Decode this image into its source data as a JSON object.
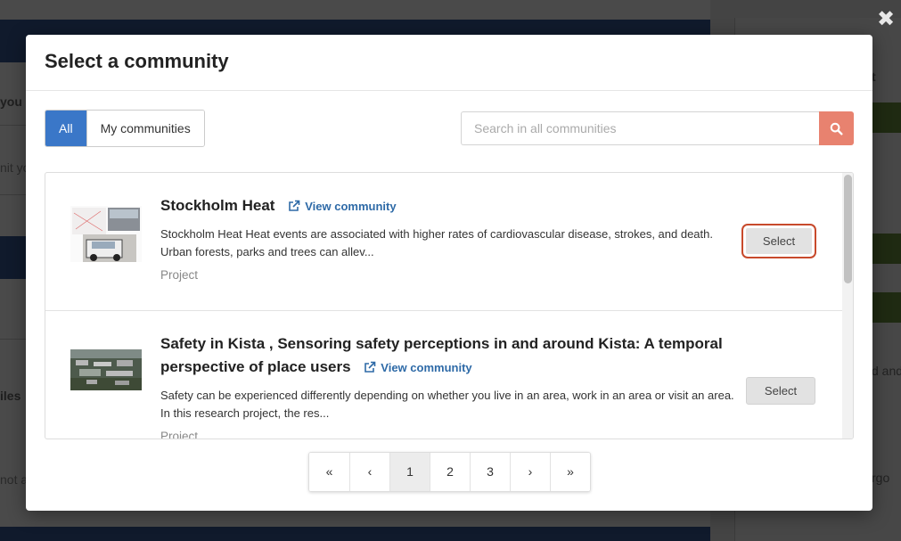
{
  "modal": {
    "title": "Select a community",
    "close_glyph": "✖"
  },
  "filters": {
    "all_label": "All",
    "mine_label": "My communities",
    "active": "All"
  },
  "search": {
    "placeholder": "Search in all communities",
    "value": "",
    "icon": "search-icon",
    "button_color": "#e8826f"
  },
  "communities": [
    {
      "title": "Stockholm Heat",
      "link_label": "View community",
      "description": "Stockholm Heat Heat events are associated with higher rates of cardiovascular disease, strokes, and death. Urban forests, parks and trees can allev...",
      "type": "Project",
      "select_label": "Select",
      "focused": true
    },
    {
      "title": "Safety in Kista , Sensoring safety perceptions in and around Kista: A temporal perspective of place users",
      "link_label": "View community",
      "description": "Safety can be experienced differently depending on whether you live in an area, work in an area or visit an area. In this research project, the res...",
      "type": "Project",
      "select_label": "Select",
      "focused": false
    }
  ],
  "pagination": {
    "first": "«",
    "prev": "‹",
    "pages": [
      "1",
      "2",
      "3"
    ],
    "current": "1",
    "next": "›",
    "last": "»"
  },
  "background": {
    "fragments": [
      "you",
      "nit yo",
      "iles",
      "not a",
      "t",
      "d and",
      "rgo"
    ]
  },
  "colors": {
    "accent": "#3a77c8",
    "link": "#2e6aa7",
    "focus_ring": "#c84a2c"
  }
}
